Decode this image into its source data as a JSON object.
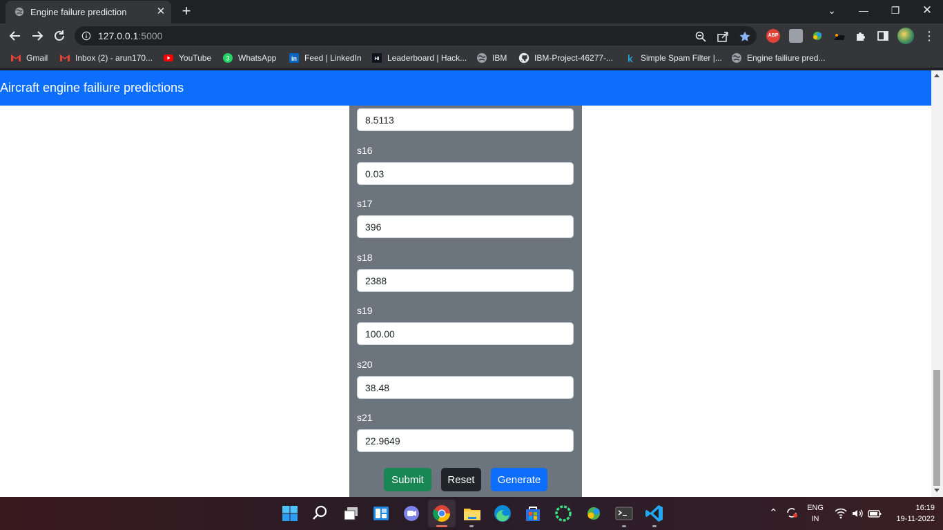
{
  "browser": {
    "tab_title": "Engine failure prediction",
    "url_host": "127.0.0.1",
    "url_port": ":5000"
  },
  "bookmarks": [
    {
      "label": "Gmail",
      "icon": "gmail-icon"
    },
    {
      "label": "Inbox (2) - arun170...",
      "icon": "gmail-icon"
    },
    {
      "label": "YouTube",
      "icon": "youtube-icon"
    },
    {
      "label": "WhatsApp",
      "icon": "whatsapp-icon"
    },
    {
      "label": "Feed | LinkedIn",
      "icon": "linkedin-icon"
    },
    {
      "label": "Leaderboard | Hack...",
      "icon": "hackerrank-icon"
    },
    {
      "label": "IBM",
      "icon": "globe-icon"
    },
    {
      "label": "IBM-Project-46277-...",
      "icon": "github-icon"
    },
    {
      "label": "Simple Spam Filter |...",
      "icon": "kaggle-icon"
    },
    {
      "label": "Engine failiure pred...",
      "icon": "globe-icon"
    }
  ],
  "page": {
    "brand": "Aircraft engine failiure predictions",
    "top_partial_value": "8.5113",
    "fields": [
      {
        "label": "s16",
        "value": "0.03"
      },
      {
        "label": "s17",
        "value": "396"
      },
      {
        "label": "s18",
        "value": "2388"
      },
      {
        "label": "s19",
        "value": "100.00"
      },
      {
        "label": "s20",
        "value": "38.48"
      },
      {
        "label": "s21",
        "value": "22.9649"
      }
    ],
    "buttons": {
      "submit": "Submit",
      "reset": "Reset",
      "generate": "Generate"
    },
    "colors": {
      "navbar": "#0d6efd",
      "panel": "#6c757d",
      "submit": "#198754",
      "reset": "#212529",
      "generate": "#0d6efd"
    }
  },
  "taskbar": {
    "language": "ENG",
    "region": "IN",
    "time": "16:19",
    "date": "19-11-2022"
  }
}
